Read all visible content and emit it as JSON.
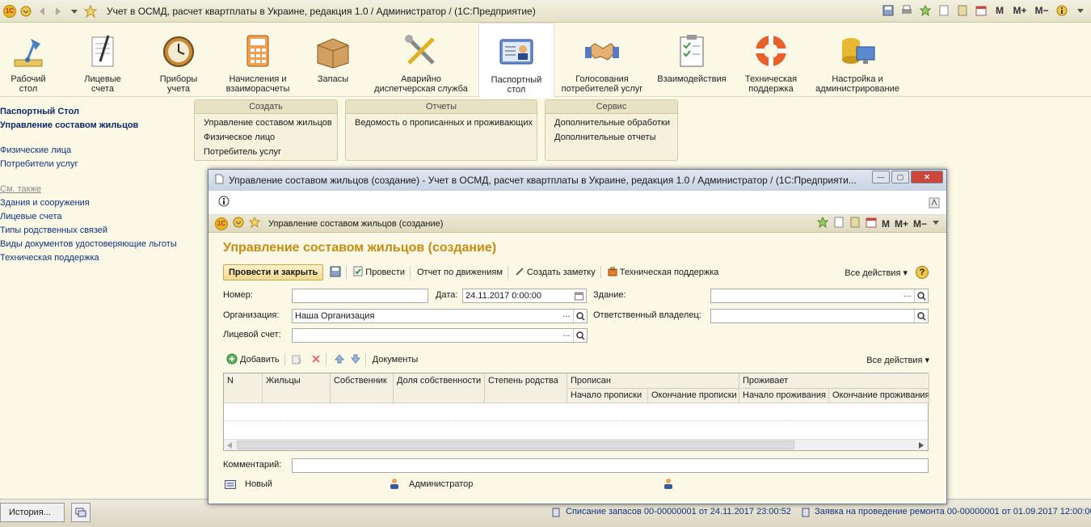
{
  "app": {
    "title": "Учет в ОСМД, расчет квартплаты в Украине, редакция 1.0 / Администратор /   (1С:Предприятие)",
    "logo_text": "1С"
  },
  "sections": [
    {
      "label": "Рабочий\nстол",
      "icon": "desk-lamp-icon"
    },
    {
      "label": "Лицевые\nсчета",
      "icon": "notepad-icon"
    },
    {
      "label": "Приборы\nучета",
      "icon": "clock-meter-icon"
    },
    {
      "label": "Начисления и\nвзаиморасчеты",
      "icon": "calculator-icon"
    },
    {
      "label": "Запасы",
      "icon": "box-icon"
    },
    {
      "label": "Аварийно\nдиспетчерская служба",
      "icon": "tools-icon"
    },
    {
      "label": "Паспортный\nстол",
      "icon": "id-card-icon"
    },
    {
      "label": "Голосования\nпотребителей услуг",
      "icon": "handshake-icon"
    },
    {
      "label": "Взаимодействия",
      "icon": "checklist-icon"
    },
    {
      "label": "Техническая\nподдержка",
      "icon": "lifebuoy-icon"
    },
    {
      "label": "Настройка и\nадминистрирование",
      "icon": "database-computer-icon"
    }
  ],
  "leftnav": {
    "items_bold": [
      "Паспортный Стол",
      "Управление составом жильцов"
    ],
    "items": [
      "Физические лица",
      "Потребители услуг"
    ],
    "see_also_title": "См. также",
    "see_also": [
      "Здания и сооружения",
      "Лицевые счета",
      "Типы родственных связей",
      "Виды документов удостоверяющие льготы",
      "Техническая поддержка"
    ]
  },
  "groups": {
    "create": {
      "title": "Создать",
      "items": [
        "Управление составом жильцов",
        "Физическое лицо",
        "Потребитель услуг"
      ]
    },
    "reports": {
      "title": "Отчеты",
      "items": [
        "Ведомость о прописанных и проживающих"
      ]
    },
    "service": {
      "title": "Сервис",
      "items": [
        "Дополнительные обработки",
        "Дополнительные отчеты"
      ]
    }
  },
  "window": {
    "title": "Управление составом жильцов (создание) - Учет в ОСМД, расчет квартплаты в Украине, редакция 1.0 / Администратор / (1С:Предприяти...",
    "tab_title": "Управление составом жильцов (создание)",
    "form_title": "Управление составом жильцов (создание)",
    "commands": {
      "post_close": "Провести и закрыть",
      "post": "Провести",
      "movements_report": "Отчет по движениям",
      "create_note": "Создать заметку",
      "support": "Техническая поддержка",
      "all_actions": "Все действия ▾",
      "help": "?"
    },
    "fields": {
      "number_label": "Номер:",
      "number_value": "",
      "date_label": "Дата:",
      "date_value": "24.11.2017  0:00:00",
      "building_label": "Здание:",
      "building_value": "",
      "org_label": "Организация:",
      "org_value": "Наша Организация",
      "owner_label": "Ответственный владелец:",
      "owner_value": "",
      "account_label": "Лицевой счет:",
      "account_value": ""
    },
    "table_toolbar": {
      "add": "Добавить",
      "documents": "Документы",
      "all_actions": "Все действия ▾"
    },
    "table": {
      "headers": [
        "N",
        "Жильцы",
        "Собственник",
        "Доля собственности",
        "Степень родства"
      ],
      "group_registered": "Прописан",
      "group_living": "Проживает",
      "sub_headers": [
        "Начало прописки",
        "Окончание прописки",
        "Начало проживания",
        "Окончание проживания"
      ],
      "rows": []
    },
    "comment_label": "Комментарий:",
    "comment_value": "",
    "footer": {
      "status": "Новый",
      "author": "Администратор"
    }
  },
  "statusbar": {
    "history": "История...",
    "msg1": "Списание запасов 00-00000001 от 24.11.2017 23:00:52",
    "msg2": "Заявка на проведение ремонта 00-00000001 от 01.09.2017 12:00:00"
  },
  "colors": {
    "accent": "#c78b10",
    "link": "#10337a",
    "background": "#fbf8e6"
  }
}
